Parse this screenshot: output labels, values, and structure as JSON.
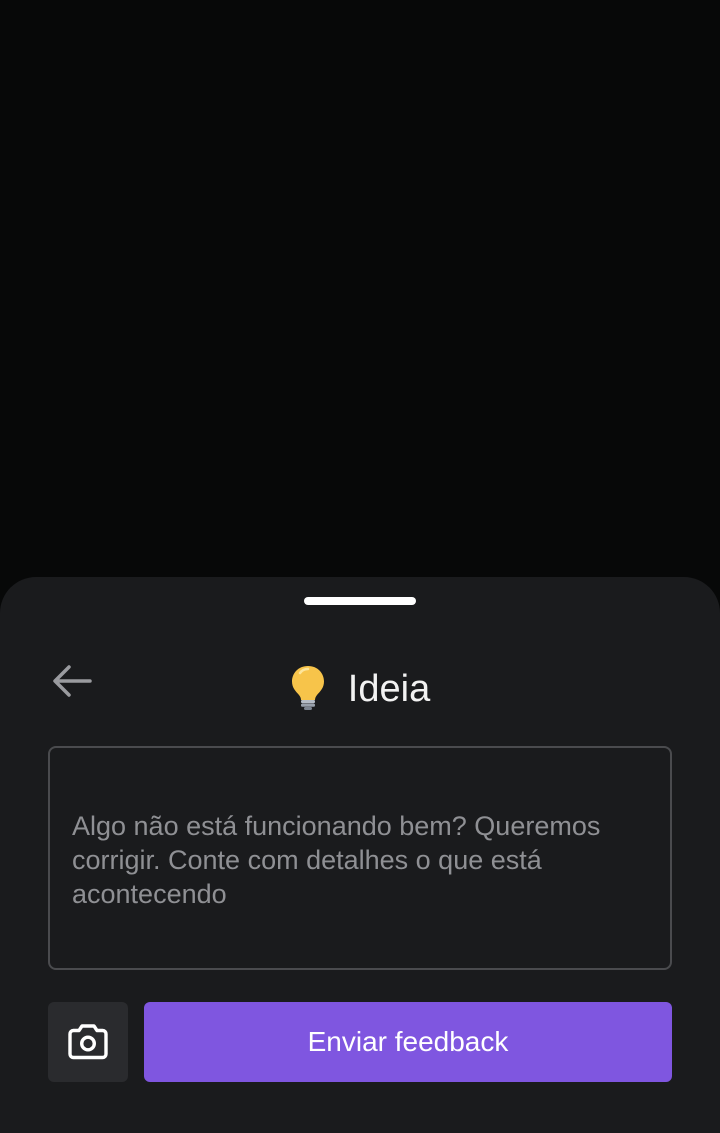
{
  "sheet": {
    "title": "Ideia",
    "title_icon": "lightbulb-icon",
    "back_icon": "arrow-left-icon"
  },
  "feedback_input": {
    "value": "",
    "placeholder": "Algo não está funcionando bem? Queremos corrigir. Conte com detalhes o que está acontecendo"
  },
  "actions": {
    "camera_icon": "camera-icon",
    "send_label": "Enviar feedback"
  },
  "colors": {
    "background": "#070808",
    "sheet": "#1a1b1d",
    "accent": "#7f56e0",
    "camera_button": "#2a2b2e",
    "placeholder_text": "#8f9094"
  }
}
